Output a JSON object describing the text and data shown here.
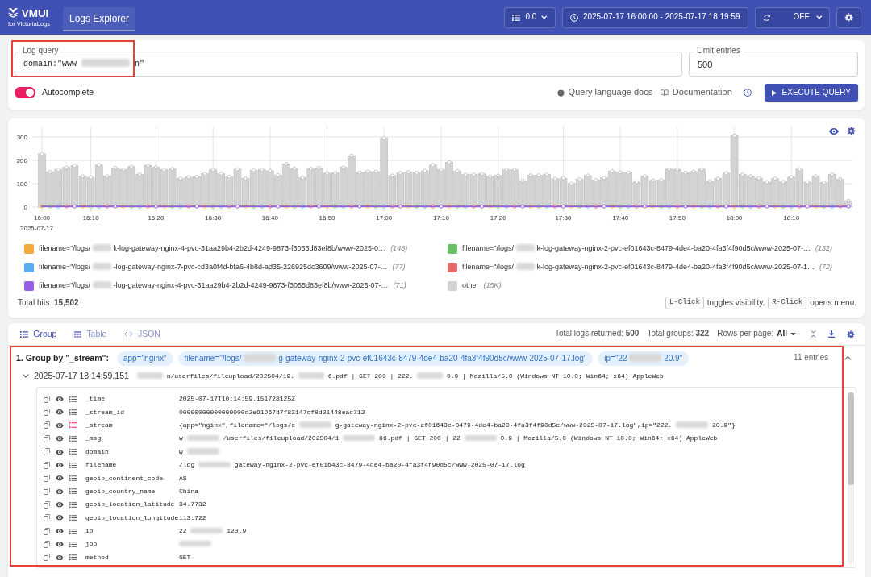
{
  "header": {
    "logo": {
      "title": "VMUI",
      "subtitle": "for VictoriaLogs"
    },
    "tabs": [
      {
        "label": "Logs Explorer",
        "selected": true
      }
    ],
    "controls": [
      {
        "kind": "tenant",
        "label": "0:0"
      },
      {
        "kind": "time_range",
        "label": "2025-07-17 16:00:00 - 2025-07-17 18:19:59"
      },
      {
        "kind": "refresh",
        "label": "OFF"
      },
      {
        "kind": "settings"
      }
    ]
  },
  "query": {
    "log_query": {
      "label": "Log query",
      "value": [
        {
          "kind": "text",
          "text": "domain:\"www"
        },
        {
          "kind": "blur"
        },
        {
          "kind": "text",
          "text": "n\""
        }
      ],
      "annotated": true
    },
    "limit": {
      "label": "Limit entries",
      "value": "500"
    },
    "autocomplete": {
      "label": "Autocomplete",
      "on": true
    },
    "links": [
      {
        "kind": "info",
        "label": "Query language docs"
      },
      {
        "kind": "book",
        "label": "Documentation"
      }
    ],
    "execute_button": {
      "label": "EXECUTE QUERY"
    }
  },
  "hits_chart": {
    "chart_data": {
      "type": "bar",
      "xlabel": "2025-07-17",
      "grid": true,
      "categories": [
        "16:00",
        null,
        null,
        null,
        null,
        null,
        "16:10",
        null,
        null,
        null,
        null,
        null,
        null,
        null,
        "16:20",
        null,
        null,
        null,
        null,
        null,
        null,
        "16:30",
        null,
        null,
        null,
        null,
        null,
        null,
        "16:40",
        null,
        null,
        null,
        null,
        null,
        null,
        "16:50",
        null,
        null,
        null,
        null,
        null,
        null,
        "17:00",
        null,
        null,
        null,
        null,
        null,
        null,
        "17:10",
        null,
        null,
        null,
        null,
        null,
        null,
        "17:20",
        null,
        null,
        null,
        null,
        null,
        null,
        null,
        "17:30",
        null,
        null,
        null,
        null,
        null,
        null,
        "17:40",
        null,
        null,
        null,
        null,
        null,
        null,
        "17:50",
        null,
        null,
        null,
        null,
        null,
        null,
        "18:00",
        null,
        null,
        null,
        null,
        null,
        null,
        "18:10",
        null,
        null,
        null,
        null,
        null,
        null,
        null
      ],
      "values": [
        228,
        150,
        160,
        170,
        177,
        132,
        127,
        180,
        132,
        168,
        160,
        173,
        140,
        178,
        170,
        160,
        163,
        122,
        128,
        130,
        143,
        160,
        143,
        130,
        162,
        123,
        158,
        160,
        155,
        137,
        185,
        165,
        126,
        165,
        168,
        145,
        146,
        170,
        220,
        148,
        152,
        152,
        295,
        135,
        147,
        150,
        147,
        155,
        180,
        160,
        192,
        154,
        139,
        139,
        142,
        131,
        135,
        160,
        160,
        113,
        136,
        136,
        140,
        121,
        124,
        101,
        119,
        135,
        116,
        125,
        154,
        149,
        148,
        107,
        132,
        114,
        116,
        162,
        162,
        147,
        152,
        162,
        111,
        122,
        145,
        306,
        140,
        132,
        124,
        107,
        122,
        108,
        128,
        162,
        107,
        132,
        105,
        140,
        119,
        27
      ],
      "ylim": [
        0,
        340
      ],
      "yticks": [
        0,
        100,
        200,
        300
      ]
    },
    "legend": [
      {
        "kind": "stream",
        "label": [
          {
            "kind": "text",
            "text": "filename=\"/logs/"
          },
          {
            "kind": "blur"
          },
          {
            "kind": "text",
            "text": "k-log-gateway-nginx-4-pvc-31aa29b4-2b2d-4249-9873-f3055d83ef8b/www-2025-0…"
          }
        ],
        "count": "(148)",
        "color": "#f5a83c"
      },
      {
        "kind": "stream",
        "label": [
          {
            "kind": "text",
            "text": "filename=\"/logs/"
          },
          {
            "kind": "blur"
          },
          {
            "kind": "text",
            "text": "k-log-gateway-nginx-2-pvc-ef01643c-8479-4de4-ba20-4fa3f4f90d5c/www-2025-07-…"
          }
        ],
        "count": "(132)",
        "color": "#6bbf6a"
      },
      {
        "kind": "stream",
        "label": [
          {
            "kind": "text",
            "text": "filename=\"/logs/"
          },
          {
            "kind": "blur"
          },
          {
            "kind": "text",
            "text": "-log-gateway-nginx-7-pvc-cd3a0f4d-bfa6-4b8d-ad35-226925dc3609/www-2025-07-…"
          }
        ],
        "count": "(77)",
        "color": "#5aabf2"
      },
      {
        "kind": "stream",
        "label": [
          {
            "kind": "text",
            "text": "filename=\"/logs/"
          },
          {
            "kind": "blur"
          },
          {
            "kind": "text",
            "text": "k-log-gateway-nginx-2-pvc-ef01643c-8479-4de4-ba20-4fa3f4f90d5c/www-2025-07-1…"
          }
        ],
        "count": "(72)",
        "color": "#e46a6a"
      },
      {
        "kind": "stream",
        "label": [
          {
            "kind": "text",
            "text": "filename=\"/logs/"
          },
          {
            "kind": "blur"
          },
          {
            "kind": "text",
            "text": "-log-gateway-nginx-4-pvc-31aa29b4-2b2d-4249-9873-f3055d83ef8b/www-2025-07-…"
          }
        ],
        "count": "(71)",
        "color": "#9560e6"
      },
      {
        "kind": "other",
        "label": [
          {
            "kind": "text",
            "text": "other"
          }
        ],
        "count": "(15K)",
        "color": "#d3d3d3"
      }
    ],
    "total_hits": "Total hits: **15,502**",
    "hints": [
      {
        "key": "L-Click",
        "text": "toggles visibility."
      },
      {
        "key": "R-Click",
        "text": "opens menu."
      }
    ]
  },
  "results": {
    "views": [
      {
        "kind": "group",
        "label": "Group",
        "selected": true
      },
      {
        "kind": "table",
        "label": "Table",
        "selected": false
      },
      {
        "kind": "json",
        "label": "JSON",
        "selected": false
      }
    ],
    "stats": [
      "Total logs returned: **500**",
      "Total groups: **322**"
    ],
    "rows_per_page": {
      "label": "Rows per page:",
      "value": "All"
    },
    "groups": [
      {
        "title": "1. Group by \"_stream\":",
        "annotated": true,
        "expanded": true,
        "tags": [
          [
            {
              "kind": "text",
              "text": "app=\"nginx\""
            }
          ],
          [
            {
              "kind": "text",
              "text": "filename=\"/logs/"
            },
            {
              "kind": "blur"
            },
            {
              "kind": "text",
              "text": "g-gateway-nginx-2-pvc-ef01643c-8479-4de4-ba20-4fa3f4f90d5c/www-2025-07-17.log\""
            }
          ],
          [
            {
              "kind": "text",
              "text": "ip=\"22"
            },
            {
              "kind": "blur"
            },
            {
              "kind": "text",
              "text": "20.9\""
            }
          ]
        ],
        "entries": "11 entries",
        "logs": [
          {
            "time": "2025-07-17 18:14:59.151",
            "message": [
              {
                "kind": "blur"
              },
              {
                "kind": "text",
                "text": "n/userfiles/fileupload/202504/19."
              },
              {
                "kind": "blur"
              },
              {
                "kind": "text",
                "text": "6.pdf | GET 200 | 222."
              },
              {
                "kind": "blur"
              },
              {
                "kind": "text",
                "text": "0.9 | Mozilla/5.0 (Windows NT 10.0; Win64; x64) AppleWeb"
              }
            ],
            "expanded": true,
            "fields": [
              {
                "key": "_time",
                "value": [
                  {
                    "kind": "text",
                    "text": "2025-07-17T10:14:59.151728125Z"
                  }
                ],
                "group_by": false
              },
              {
                "key": "_stream_id",
                "value": [
                  {
                    "kind": "text",
                    "text": "00000000000000000d2e91967d7f83147cf8d21448eac712"
                  }
                ],
                "group_by": false
              },
              {
                "key": "_stream",
                "value": [
                  {
                    "kind": "text",
                    "text": "{app=\"nginx\",filename=\"/logs/c"
                  },
                  {
                    "kind": "blur"
                  },
                  {
                    "kind": "text",
                    "text": "g-gateway-nginx-2-pvc-ef01643c-8479-4de4-ba20-4fa3f4f90d5c/www-2025-07-17.log\",ip=\"222."
                  },
                  {
                    "kind": "blur"
                  },
                  {
                    "kind": "text",
                    "text": "20.9\"}"
                  }
                ],
                "group_by": true
              },
              {
                "key": "_msg",
                "value": [
                  {
                    "kind": "text",
                    "text": "w"
                  },
                  {
                    "kind": "blur"
                  },
                  {
                    "kind": "text",
                    "text": "/userfiles/fileupload/202504/1"
                  },
                  {
                    "kind": "blur"
                  },
                  {
                    "kind": "text",
                    "text": "86.pdf | GET 200 | 22"
                  },
                  {
                    "kind": "blur"
                  },
                  {
                    "kind": "text",
                    "text": "0.9 | Mozilla/5.0 (Windows NT 10.0; Win64; x64) AppleWeb"
                  }
                ],
                "group_by": false
              },
              {
                "key": "domain",
                "value": [
                  {
                    "kind": "text",
                    "text": "w"
                  },
                  {
                    "kind": "blur"
                  }
                ],
                "group_by": false
              },
              {
                "key": "filename",
                "value": [
                  {
                    "kind": "text",
                    "text": "/log"
                  },
                  {
                    "kind": "blur"
                  },
                  {
                    "kind": "text",
                    "text": "gateway-nginx-2-pvc-ef01643c-8479-4de4-ba20-4fa3f4f90d5c/www-2025-07-17.log"
                  }
                ],
                "group_by": false
              },
              {
                "key": "geoip_continent_code",
                "value": [
                  {
                    "kind": "text",
                    "text": "AS"
                  }
                ],
                "group_by": false
              },
              {
                "key": "geoip_country_name",
                "value": [
                  {
                    "kind": "text",
                    "text": "China"
                  }
                ],
                "group_by": false
              },
              {
                "key": "geoip_location_latitude",
                "value": [
                  {
                    "kind": "text",
                    "text": "34.7732"
                  }
                ],
                "group_by": false
              },
              {
                "key": "geoip_location_longitude",
                "value": [
                  {
                    "kind": "text",
                    "text": "113.722"
                  }
                ],
                "group_by": false
              },
              {
                "key": "ip",
                "value": [
                  {
                    "kind": "text",
                    "text": "22"
                  },
                  {
                    "kind": "blur"
                  },
                  {
                    "kind": "text",
                    "text": "120.9"
                  }
                ],
                "group_by": false
              },
              {
                "key": "job",
                "value": [
                  {
                    "kind": "blur"
                  }
                ],
                "group_by": false
              },
              {
                "key": "method",
                "value": [
                  {
                    "kind": "text",
                    "text": "GET"
                  }
                ],
                "group_by": false
              }
            ]
          }
        ]
      }
    ]
  }
}
